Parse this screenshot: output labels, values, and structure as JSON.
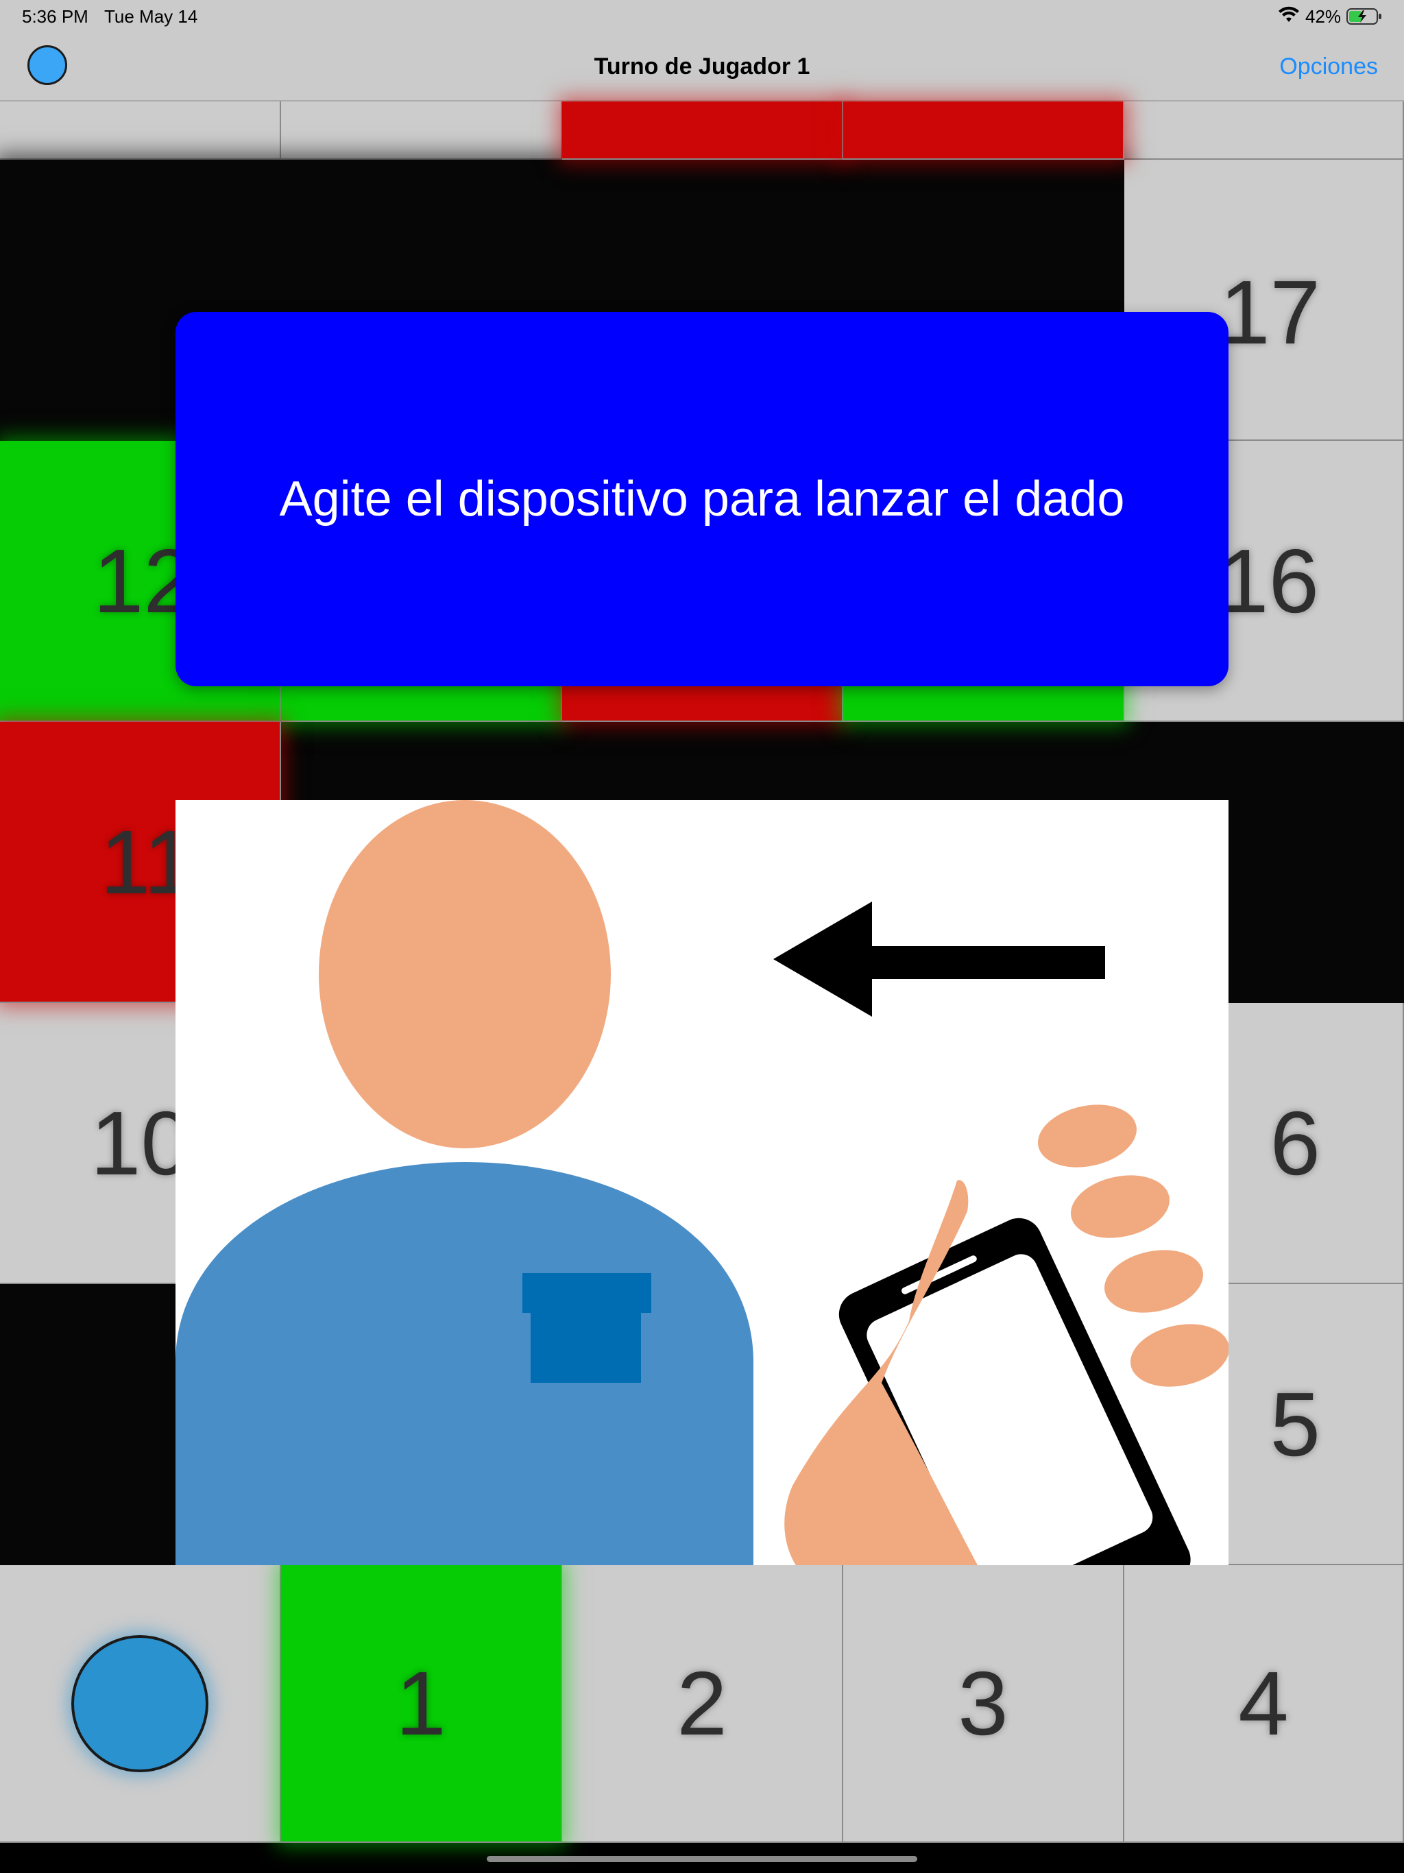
{
  "status_bar": {
    "time": "5:36 PM",
    "date": "Tue May 14",
    "battery": "42%"
  },
  "nav": {
    "title": "Turno de Jugador 1",
    "options_label": "Opciones",
    "player_color": "#3aa6f5"
  },
  "board": {
    "tiles": [
      "1",
      "2",
      "3",
      "4",
      "5",
      "6",
      "10",
      "11",
      "12",
      "16",
      "17"
    ]
  },
  "popup": {
    "message": "Agite el dispositivo para lanzar el dado"
  },
  "colors": {
    "green": "#05cc05",
    "red": "#cc0606",
    "grey": "#cccccc",
    "popup_blue": "#0000ff",
    "link_blue": "#1a8cff"
  }
}
